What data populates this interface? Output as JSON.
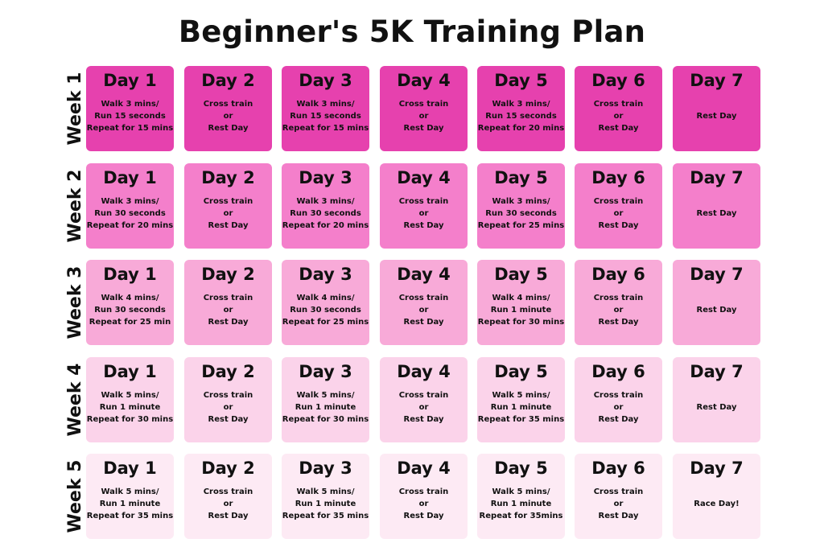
{
  "title": "Beginner's 5K Training Plan",
  "colors": {
    "week1": "#e641ae",
    "week2": "#f47fcb",
    "week3": "#f8aad8",
    "week4": "#fbd3ea",
    "week5": "#fdeaf4"
  },
  "weeks": [
    {
      "label": "Week 1",
      "days": [
        {
          "day": "Day 1",
          "lines": [
            "Walk 3 mins/",
            "Run 15 seconds",
            "Repeat for 15 mins"
          ]
        },
        {
          "day": "Day 2",
          "lines": [
            "Cross train",
            "or",
            "Rest Day"
          ]
        },
        {
          "day": "Day 3",
          "lines": [
            "Walk 3 mins/",
            "Run 15 seconds",
            "Repeat for 15 mins"
          ]
        },
        {
          "day": "Day 4",
          "lines": [
            "Cross train",
            "or",
            "Rest Day"
          ]
        },
        {
          "day": "Day 5",
          "lines": [
            "Walk 3 mins/",
            "Run 15 seconds",
            "Repeat for 20 mins"
          ]
        },
        {
          "day": "Day 6",
          "lines": [
            "Cross train",
            "or",
            "Rest Day"
          ]
        },
        {
          "day": "Day 7",
          "lines": [
            "Rest Day"
          ]
        }
      ]
    },
    {
      "label": "Week 2",
      "days": [
        {
          "day": "Day 1",
          "lines": [
            "Walk 3 mins/",
            "Run 30 seconds",
            "Repeat for 20 mins"
          ]
        },
        {
          "day": "Day 2",
          "lines": [
            "Cross train",
            "or",
            "Rest Day"
          ]
        },
        {
          "day": "Day 3",
          "lines": [
            "Walk 3 mins/",
            "Run 30 seconds",
            "Repeat for 20 mins"
          ]
        },
        {
          "day": "Day 4",
          "lines": [
            "Cross train",
            "or",
            "Rest Day"
          ]
        },
        {
          "day": "Day 5",
          "lines": [
            "Walk 3 mins/",
            "Run 30 seconds",
            "Repeat for 25 mins"
          ]
        },
        {
          "day": "Day 6",
          "lines": [
            "Cross train",
            "or",
            "Rest Day"
          ]
        },
        {
          "day": "Day 7",
          "lines": [
            "Rest Day"
          ]
        }
      ]
    },
    {
      "label": "Week 3",
      "days": [
        {
          "day": "Day 1",
          "lines": [
            "Walk 4 mins/",
            "Run 30 seconds",
            "Repeat for 25 min"
          ]
        },
        {
          "day": "Day 2",
          "lines": [
            "Cross train",
            "or",
            "Rest Day"
          ]
        },
        {
          "day": "Day 3",
          "lines": [
            "Walk 4 mins/",
            "Run 30 seconds",
            "Repeat for 25 mins"
          ]
        },
        {
          "day": "Day 4",
          "lines": [
            "Cross train",
            "or",
            "Rest Day"
          ]
        },
        {
          "day": "Day 5",
          "lines": [
            "Walk 4 mins/",
            "Run 1 minute",
            "Repeat for 30 mins"
          ]
        },
        {
          "day": "Day 6",
          "lines": [
            "Cross train",
            "or",
            "Rest Day"
          ]
        },
        {
          "day": "Day 7",
          "lines": [
            "Rest Day"
          ]
        }
      ]
    },
    {
      "label": "Week 4",
      "days": [
        {
          "day": "Day 1",
          "lines": [
            "Walk 5 mins/",
            "Run 1 minute",
            "Repeat for 30 mins"
          ]
        },
        {
          "day": "Day 2",
          "lines": [
            "Cross train",
            "or",
            "Rest Day"
          ]
        },
        {
          "day": "Day 3",
          "lines": [
            "Walk 5 mins/",
            "Run 1 minute",
            "Repeat for 30 mins"
          ]
        },
        {
          "day": "Day 4",
          "lines": [
            "Cross train",
            "or",
            "Rest Day"
          ]
        },
        {
          "day": "Day 5",
          "lines": [
            "Walk 5 mins/",
            "Run 1 minute",
            "Repeat for 35 mins"
          ]
        },
        {
          "day": "Day 6",
          "lines": [
            "Cross train",
            "or",
            "Rest Day"
          ]
        },
        {
          "day": "Day 7",
          "lines": [
            "Rest Day"
          ]
        }
      ]
    },
    {
      "label": "Week 5",
      "days": [
        {
          "day": "Day 1",
          "lines": [
            "Walk 5 mins/",
            "Run 1 minute",
            "Repeat for 35 mins"
          ]
        },
        {
          "day": "Day 2",
          "lines": [
            "Cross train",
            "or",
            "Rest Day"
          ]
        },
        {
          "day": "Day 3",
          "lines": [
            "Walk 5 mins/",
            "Run 1 minute",
            "Repeat for 35 mins"
          ]
        },
        {
          "day": "Day 4",
          "lines": [
            "Cross train",
            "or",
            "Rest Day"
          ]
        },
        {
          "day": "Day 5",
          "lines": [
            "Walk 5 mins/",
            "Run 1 minute",
            "Repeat for 35mins"
          ]
        },
        {
          "day": "Day 6",
          "lines": [
            "Cross train",
            "or",
            "Rest Day"
          ]
        },
        {
          "day": "Day 7",
          "lines": [
            "Race Day!"
          ]
        }
      ]
    }
  ]
}
